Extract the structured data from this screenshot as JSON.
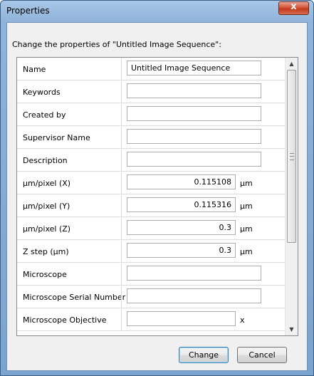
{
  "window": {
    "title": "Properties",
    "close_glyph": "x"
  },
  "prompt": "Change the properties of \"Untitled Image Sequence\":",
  "rows": [
    {
      "label": "Name",
      "value": "Untitled Image Sequence",
      "unit": ""
    },
    {
      "label": "Keywords",
      "value": "",
      "unit": ""
    },
    {
      "label": "Created by",
      "value": "",
      "unit": ""
    },
    {
      "label": "Supervisor Name",
      "value": "",
      "unit": ""
    },
    {
      "label": "Description",
      "value": "",
      "unit": ""
    },
    {
      "label": "µm/pixel (X)",
      "value": "0.115108",
      "unit": "µm"
    },
    {
      "label": "µm/pixel (Y)",
      "value": "0.115316",
      "unit": "µm"
    },
    {
      "label": "µm/pixel (Z)",
      "value": "0.3",
      "unit": "µm"
    },
    {
      "label": "Z step (µm)",
      "value": "0.3",
      "unit": "µm"
    },
    {
      "label": "Microscope",
      "value": "",
      "unit": ""
    },
    {
      "label": "Microscope Serial Number",
      "value": "",
      "unit": ""
    },
    {
      "label": "Microscope Objective",
      "value": "",
      "unit": "x"
    }
  ],
  "buttons": {
    "change": "Change",
    "cancel": "Cancel"
  },
  "icons": {
    "scroll_up": "scroll-up-arrow-icon",
    "scroll_down": "scroll-down-arrow-icon",
    "close": "close-icon"
  }
}
